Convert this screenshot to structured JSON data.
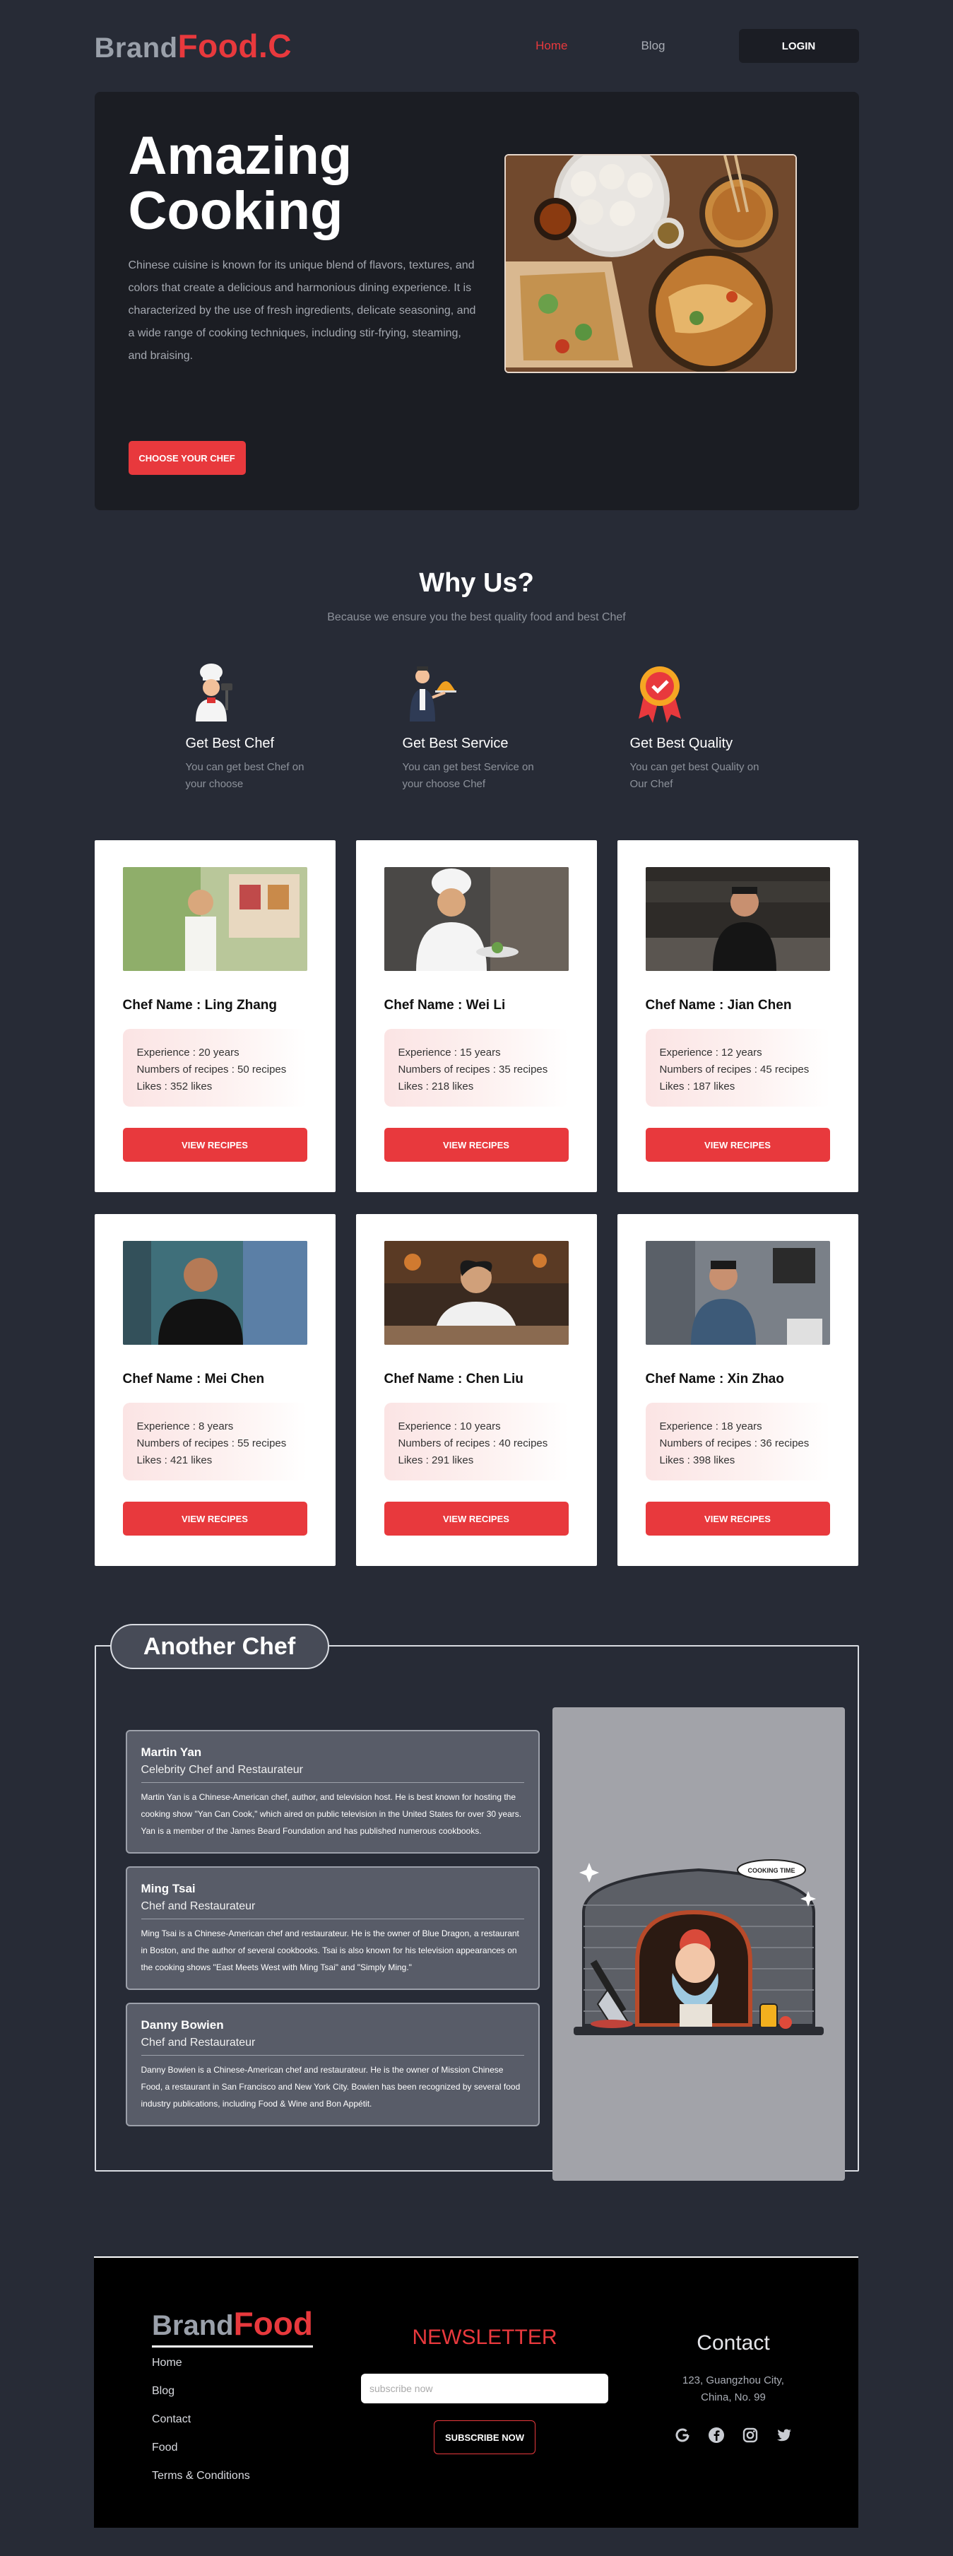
{
  "nav": {
    "brand_a": "Brand",
    "brand_b": "Food.C",
    "links": [
      "Home",
      "Blog"
    ],
    "login": "LOGIN"
  },
  "hero": {
    "title": "Amazing Cooking",
    "desc": "Chinese cuisine is known for its unique blend of flavors, textures, and colors that create a delicious and harmonious dining experience. It is characterized by the use of fresh ingredients, delicate seasoning, and a wide range of cooking techniques, including stir-frying, steaming, and braising.",
    "button": "CHOOSE YOUR CHEF"
  },
  "why": {
    "title": "Why Us?",
    "subtitle": "Because we ensure you the best quality food and best Chef",
    "features": [
      {
        "title": "Get Best Chef",
        "text": "You can get best Chef on your choose"
      },
      {
        "title": "Get Best Service",
        "text": "You can get best Service on your choose Chef"
      },
      {
        "title": "Get Best Quality",
        "text": "You can get best Quality on Our Chef"
      }
    ]
  },
  "chefs": [
    {
      "name": "Chef Name : Ling Zhang",
      "experience": "Experience : 20 years",
      "recipes": "Numbers of recipes : 50 recipes",
      "likes": "Likes : 352 likes",
      "button": "VIEW RECIPES"
    },
    {
      "name": "Chef Name : Wei Li",
      "experience": "Experience : 15 years",
      "recipes": "Numbers of recipes : 35 recipes",
      "likes": "Likes : 218 likes",
      "button": "VIEW RECIPES"
    },
    {
      "name": "Chef Name : Jian Chen",
      "experience": "Experience : 12 years",
      "recipes": "Numbers of recipes : 45 recipes",
      "likes": "Likes : 187 likes",
      "button": "VIEW RECIPES"
    },
    {
      "name": "Chef Name : Mei Chen",
      "experience": "Experience : 8 years",
      "recipes": "Numbers of recipes : 55 recipes",
      "likes": "Likes : 421 likes",
      "button": "VIEW RECIPES"
    },
    {
      "name": "Chef Name : Chen Liu",
      "experience": "Experience : 10 years",
      "recipes": "Numbers of recipes : 40 recipes",
      "likes": "Likes : 291 likes",
      "button": "VIEW RECIPES"
    },
    {
      "name": "Chef Name : Xin Zhao",
      "experience": "Experience : 18 years",
      "recipes": "Numbers of recipes : 36 recipes",
      "likes": "Likes : 398 likes",
      "button": "VIEW RECIPES"
    }
  ],
  "another": {
    "title": "Another Chef",
    "illustration_sign": "COOKING TIME",
    "bios": [
      {
        "name": "Martin Yan",
        "role": "Celebrity Chef and Restaurateur",
        "text": "Martin Yan is a Chinese-American chef, author, and television host. He is best known for hosting the cooking show \"Yan Can Cook,\" which aired on public television in the United States for over 30 years. Yan is a member of the James Beard Foundation and has published numerous cookbooks."
      },
      {
        "name": "Ming Tsai",
        "role": "Chef and Restaurateur",
        "text": "Ming Tsai is a Chinese-American chef and restaurateur. He is the owner of Blue Dragon, a restaurant in Boston, and the author of several cookbooks. Tsai is also known for his television appearances on the cooking shows \"East Meets West with Ming Tsai\" and \"Simply Ming.\""
      },
      {
        "name": "Danny Bowien",
        "role": "Chef and Restaurateur",
        "text": "Danny Bowien is a Chinese-American chef and restaurateur. He is the owner of Mission Chinese Food, a restaurant in San Francisco and New York City. Bowien has been recognized by several food industry publications, including Food & Wine and Bon Appétit."
      }
    ]
  },
  "footer": {
    "brand_a": "Brand",
    "brand_b": "Food",
    "links": [
      "Home",
      "Blog",
      "Contact",
      "Food",
      "Terms & Conditions"
    ],
    "newsletter_title": "NEWSLETTER",
    "newsletter_placeholder": "subscribe now",
    "newsletter_button": "SUBSCRIBE NOW",
    "contact_title": "Contact",
    "address_line1": "123, Guangzhou City,",
    "address_line2": "China, No. 99",
    "socials": [
      "google-icon",
      "facebook-icon",
      "instagram-icon",
      "twitter-icon"
    ]
  },
  "colors": {
    "accent": "#e8393d",
    "page_bg": "#272b36",
    "panel_bg": "#1b1d23"
  }
}
